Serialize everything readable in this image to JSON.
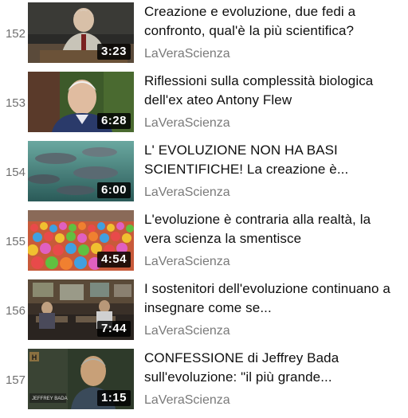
{
  "playlist": {
    "items": [
      {
        "index": "152",
        "title": "Creazione e evoluzione, due fedi a confronto, qual'è la più scientifica?",
        "duration": "3:23",
        "channel": "LaVeraScienza",
        "thumb_icon": "man-seated-interview-thumbnail"
      },
      {
        "index": "153",
        "title": "Riflessioni sulla complessità biologica dell'ex ateo Antony Flew",
        "duration": "6:28",
        "channel": "LaVeraScienza",
        "thumb_icon": "elderly-man-portrait-thumbnail"
      },
      {
        "index": "154",
        "title": "L' EVOLUZIONE NON HA BASI SCIENTIFICHE! La creazione è...",
        "duration": "6:00",
        "channel": "LaVeraScienza",
        "thumb_icon": "dolphins-underwater-thumbnail"
      },
      {
        "index": "155",
        "title": "L'evoluzione è contraria alla realtà, la vera scienza la smentisce",
        "duration": "4:54",
        "channel": "LaVeraScienza",
        "thumb_icon": "colored-balls-thumbnail"
      },
      {
        "index": "156",
        "title": "I sostenitori dell'evoluzione continuano a insegnare come se...",
        "duration": "7:44",
        "channel": "LaVeraScienza",
        "thumb_icon": "control-room-thumbnail"
      },
      {
        "index": "157",
        "title": "CONFESSIONE di Jeffrey Bada sull'evoluzione: \"il più grande...",
        "duration": "1:15",
        "channel": "LaVeraScienza",
        "thumb_icon": "man-interview-history-channel-thumbnail",
        "thumb_caption": "JEFFREY BADA"
      }
    ]
  }
}
